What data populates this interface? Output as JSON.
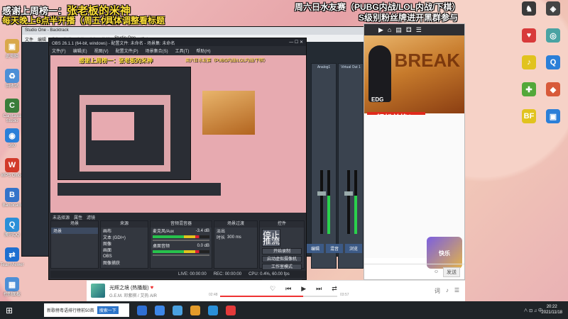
{
  "overlay": {
    "line1_prefix": "感谢上周榜一：",
    "line1_name": "张老板的米神",
    "line2": "每天晚上6点半开播（周五休息）",
    "line3": "具体调整看标题",
    "line4": "周六日水友赛（PUBG内战/LOL内战/下棋）",
    "line5": "S级别粉丝牌进开黑群参与"
  },
  "desktop_icons_left": [
    {
      "label": "此电脑",
      "color": "#d9a84a",
      "glyph": "▣"
    },
    {
      "label": "回收站",
      "color": "#4d8fd6",
      "glyph": "♻"
    },
    {
      "label": "Camtasia Studio",
      "color": "#3a7d3a",
      "glyph": "C"
    },
    {
      "label": "360",
      "color": "#2b7fd8",
      "glyph": "◉"
    },
    {
      "label": "WPS Office",
      "color": "#d23a2a",
      "glyph": "W"
    },
    {
      "label": "Bandicam",
      "color": "#3473c9",
      "glyph": "B"
    },
    {
      "label": "腾讯QQ",
      "color": "#2b8fd8",
      "glyph": "Q"
    },
    {
      "label": "TeamViewer",
      "color": "#1e6fd0",
      "glyph": "⇄"
    },
    {
      "label": "控制面板",
      "color": "#4d8fd6",
      "glyph": "▦"
    }
  ],
  "desktop_icons_right": [
    {
      "label": "",
      "color": "#3a3a3a",
      "glyph": "♞"
    },
    {
      "label": "",
      "color": "#444",
      "glyph": "◈"
    },
    {
      "label": "",
      "color": "#d83a3a",
      "glyph": "♥"
    },
    {
      "label": "",
      "color": "#4aa3a3",
      "glyph": "◎"
    },
    {
      "label": "",
      "color": "#e1c31e",
      "glyph": "♪"
    },
    {
      "label": "",
      "color": "#2b7fd8",
      "glyph": "Q"
    },
    {
      "label": "",
      "color": "#53a83a",
      "glyph": "✚"
    },
    {
      "label": "",
      "color": "#d85a3a",
      "glyph": "◆"
    },
    {
      "label": "BF",
      "color": "#e1c31e",
      "glyph": "BF"
    },
    {
      "label": "",
      "color": "#2b7fd8",
      "glyph": "▣"
    }
  ],
  "studio": {
    "title": "Studio One - Backtrack",
    "menu": [
      "文件",
      "编辑",
      "乐曲",
      "轨道",
      "事件",
      "音频",
      "传输",
      "Studio One",
      "帮助"
    ],
    "strips": [
      "Analog1",
      "Virtual Out 1"
    ],
    "bottom_buttons": [
      "编辑",
      "混音",
      "浏览"
    ]
  },
  "browser": {
    "tab_icons": [
      "▶",
      "⌂",
      "▤",
      "⚃",
      "☰"
    ],
    "banner_text": "BREAK",
    "team": "EDG",
    "cta": "轻松兑换！",
    "promo_badge": "快乐",
    "send_label": "发送",
    "input_hint": "☺"
  },
  "obs": {
    "title": "OBS 26.1.1 (64-bit, windows) - 配置文件: 未命名 - 场景集: 未命名",
    "menu": [
      "文件(F)",
      "编辑(E)",
      "视图(V)",
      "配置文件(P)",
      "场景集合(S)",
      "工具(T)",
      "帮助(H)"
    ],
    "preview_text1": "感谢上周榜一：张老板的米神",
    "preview_text2": "周六日水友赛（PUBG内战/LOL内战/下棋）",
    "docks_header": [
      "未选择源",
      "属性",
      "滤镜"
    ],
    "scenes_title": "场景",
    "scenes": [
      "场景"
    ],
    "sources_title": "来源",
    "sources": [
      "画布",
      "文本 (GDI+)",
      "图像",
      "画面",
      "OBS",
      "图像捕获"
    ],
    "mixer_title": "音频混音器",
    "mixer": [
      {
        "name": "麦克风/Aux",
        "level": "-3.4 dB"
      },
      {
        "name": "桌面音频",
        "level": "0.0 dB"
      }
    ],
    "transitions_title": "场景过渡",
    "transition_type": "淡出",
    "duration_label": "时长",
    "duration": "300 ms",
    "controls_title": "控件",
    "controls": [
      "停止推流",
      "开始录制",
      "启动虚拟摄像机",
      "工作室模式",
      "设置",
      "退出"
    ],
    "status": [
      "LIVE: 00:00:00",
      "REC: 00:00:00",
      "CPU: 0.4%, 60.00 fps"
    ]
  },
  "player": {
    "song": "光辉之境 (热播版)",
    "artist": "G.E.M. 邓紫棋 / 艾热 AIR",
    "time_elapsed": "02:48",
    "time_total": "03:57",
    "progress": 0.71,
    "controls": [
      "♡",
      "⏮",
      "▶",
      "⏭",
      "⇄"
    ],
    "right_controls": [
      "词",
      "♪",
      "☰"
    ]
  },
  "taskbar": {
    "start_icon": "⊞",
    "search_text": "新歌榜粤语排行榜前50首",
    "search_button": "搜索一下",
    "app_colors": [
      "#2f6fd3",
      "#3d87e8",
      "#4aa1e0",
      "#e39b2a",
      "#2a8fd8",
      "#e33a3a"
    ],
    "tray_text": "∧  ⊡  ♫  中",
    "time": "20:22",
    "date": "2021/11/18"
  }
}
